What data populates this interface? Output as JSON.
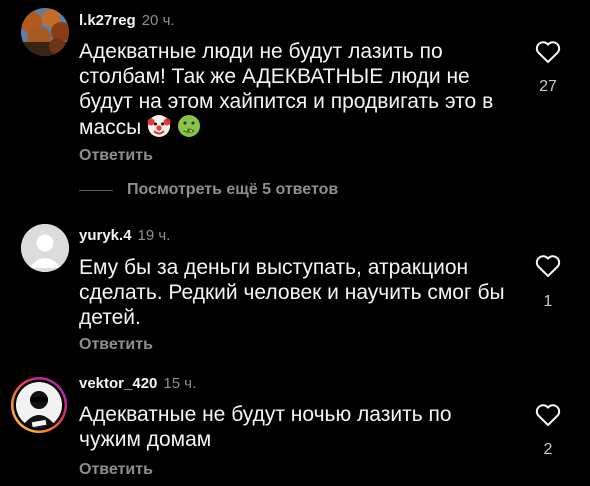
{
  "comments": [
    {
      "username": "l.k27reg",
      "time": "20 ч.",
      "text": "Адекватные люди не будут лазить по столбам! Так же АДЕКВАТНЫЕ люди не будут на этом хайпится и продвигать это в массы",
      "emojis": [
        "clown-face",
        "nauseated-face"
      ],
      "reply_label": "Ответить",
      "likes": "27"
    },
    {
      "username": "yuryk.4",
      "time": "19 ч.",
      "text": "Ему бы за деньги выступать, атракцион сделать. Редкий человек и научить смог бы детей.",
      "reply_label": "Ответить",
      "likes": "1"
    },
    {
      "username": "vektor_420",
      "time": "15 ч.",
      "text": "Адекватные не будут ночью лазить по чужим домам",
      "reply_label": "Ответить",
      "likes": "2"
    }
  ],
  "view_more_replies": "Посмотреть ещё 5 ответов",
  "icons": {
    "like": "heart-outline-icon"
  },
  "colors": {
    "background": "#000000",
    "text": "#f5f5f5",
    "muted": "#8e8e8e",
    "story_ring": "#d62976"
  }
}
